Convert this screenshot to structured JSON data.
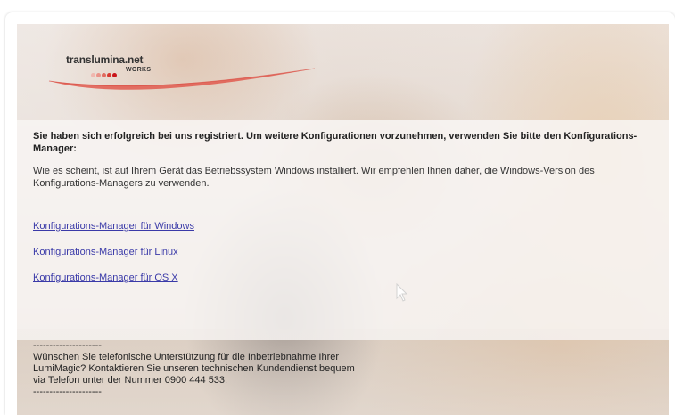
{
  "logo": {
    "name": "translumina.net",
    "sub": "WORKS",
    "dot_colors": [
      "#f0b6ae",
      "#ea9389",
      "#e06a5f",
      "#d83a31",
      "#c9141a"
    ]
  },
  "main": {
    "title": "Sie haben sich erfolgreich bei uns registriert. Um weitere Konfigurationen vorzunehmen, verwenden Sie bitte den Konfigurations-Manager:",
    "body": "Wie es scheint, ist auf Ihrem Gerät das Betriebssystem Windows installiert. Wir empfehlen Ihnen daher, die Windows-Version des Konfigurations-Managers zu verwenden.",
    "links": [
      "Konfigurations-Manager für Windows",
      "Konfigurations-Manager für Linux",
      "Konfigurations-Manager für OS X"
    ]
  },
  "footer": {
    "separator": "---------------------",
    "lines": [
      "Wünschen Sie telefonische Unterstützung für die Inbetriebnahme Ihrer",
      "LumiMagic? Kontaktieren Sie unseren technischen Kundendienst bequem",
      "via Telefon unter der Nummer 0900 444 533."
    ]
  },
  "colors": {
    "link": "#3a3aa8",
    "brand_red": "#c9141a"
  }
}
